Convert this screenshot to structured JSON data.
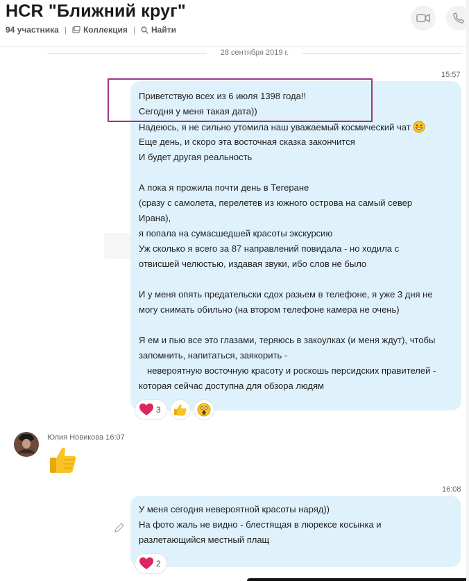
{
  "header": {
    "title": "HCR \"Ближний круг\"",
    "participants": "94 участника",
    "collection_label": "Коллекция",
    "find_label": "Найти"
  },
  "chat": {
    "date_separator": "28 сентября 2019 г.",
    "messages": [
      {
        "time": "15:57",
        "lines": [
          "Приветствую всех из 6 июля 1398 года!!",
          "Сегодня у меня такая дата))",
          "Надеюсь, я не сильно утомила наш уважаемый космический чат",
          "Еще день, и скоро эта восточная сказка закончится",
          "И будет другая реальность",
          "",
          "А пока я прожила почти день в Тегеране",
          "(сразу с самолета, перелетев из южного острова на самый север",
          "Ирана),",
          "я попала на сумасшедшей красоты экскурсию",
          "Уж сколько я всего за 87 направлений повидала - но ходила с",
          "отвисшей челюстью, издавая звуки, ибо слов не было",
          "",
          "И у меня опять предательски сдох разьем в телефоне, я уже 3 дня не",
          "могу снимать обильно (на втором телефоне камера не очень)",
          "",
          "Я ем и пью все это глазами, теряюсь в закоулках (и меня ждут), чтобы",
          "запомнить, напитаться, заякорить -",
          "невероятную восточную красоту и роскошь персидских правителей -",
          "которая сейчас доступна для обзора людям"
        ],
        "reactions": [
          {
            "icon": "heart-icon",
            "count": "3"
          },
          {
            "icon": "thumbs-up-icon",
            "count": ""
          },
          {
            "icon": "surprised-face-icon",
            "count": ""
          }
        ]
      },
      {
        "sender": "Юлия Новикова",
        "time": "16:07",
        "content_icon": "thumbs-up-icon"
      },
      {
        "time": "16:08",
        "lines": [
          "У меня сегодня невероятной красоты наряд))",
          "На фото жаль не видно - блестящая в люрексе косынка и",
          "разлетающийся местный плащ"
        ],
        "reactions": [
          {
            "icon": "heart-icon",
            "count": "2"
          }
        ]
      }
    ]
  },
  "colors": {
    "bubble": "#dff1fb",
    "highlight": "#a0338c",
    "heart": "#e0245e",
    "thumb": "#f7c325"
  }
}
